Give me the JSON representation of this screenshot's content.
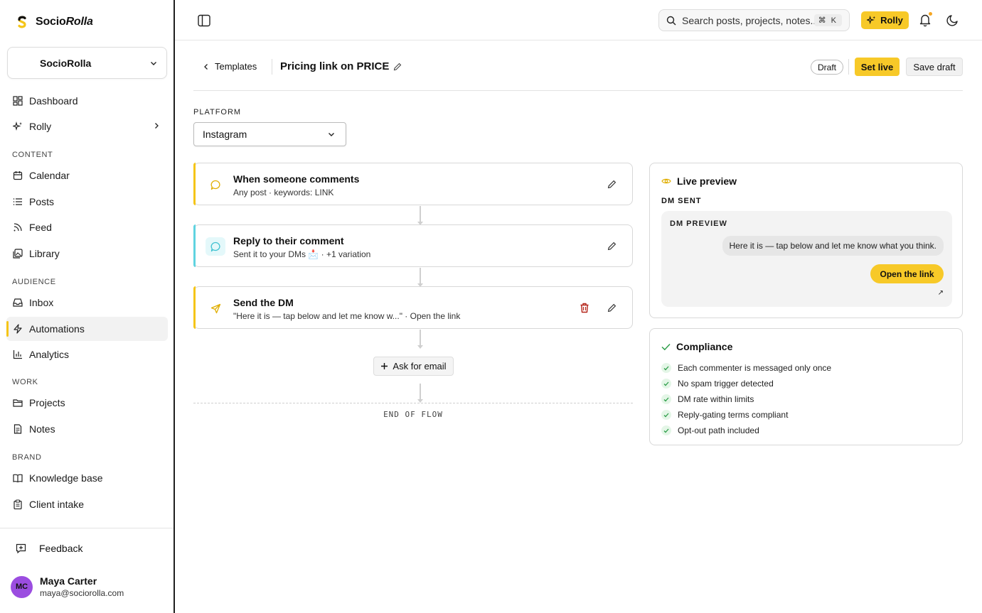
{
  "brand": {
    "name_plain": "Socio",
    "name_italic": "Rolla"
  },
  "workspace": {
    "name": "SocioRolla"
  },
  "nav": {
    "dashboard": "Dashboard",
    "rolly": "Rolly",
    "sections": {
      "content": "CONTENT",
      "audience": "AUDIENCE",
      "work": "WORK",
      "brand": "BRAND"
    },
    "calendar": "Calendar",
    "posts": "Posts",
    "feed": "Feed",
    "library": "Library",
    "inbox": "Inbox",
    "automations": "Automations",
    "analytics": "Analytics",
    "projects": "Projects",
    "notes": "Notes",
    "knowledge_base": "Knowledge base",
    "client_intake": "Client intake",
    "active": "automations"
  },
  "feedback": "Feedback",
  "user": {
    "initials": "MC",
    "name": "Maya Carter",
    "email": "maya@sociorolla.com",
    "avatar_color": "#9b4de0"
  },
  "topbar": {
    "search_placeholder": "Search posts, projects, notes...",
    "search_shortcut": "⌘ K",
    "rolly_label": "Rolly"
  },
  "header": {
    "back_label": "Templates",
    "title": "Pricing link on PRICE",
    "status": "Draft",
    "set_live": "Set live",
    "save_draft": "Save draft"
  },
  "platform": {
    "label": "PLATFORM",
    "value": "Instagram"
  },
  "flow": {
    "steps": [
      {
        "title": "When someone comments",
        "subtitle": "Any post · keywords: LINK",
        "accent": "#f5c518",
        "icon": "comment-icon"
      },
      {
        "title": "Reply to their comment",
        "subtitle": "Sent it to your DMs 📩 · +1 variation",
        "accent": "#5fd3e0",
        "icon": "comment-icon"
      },
      {
        "title": "Send the DM",
        "subtitle": "\"Here it is — tap below and let me know w...\" · Open the link",
        "accent": "#f5c518",
        "icon": "send-icon"
      }
    ],
    "ask_email": "Ask for email",
    "end": "END OF FLOW"
  },
  "preview": {
    "title": "Live preview",
    "state": "DM SENT",
    "box_label": "DM PREVIEW",
    "message": "Here it is — tap below and let me know what you think.",
    "button": "Open the link",
    "arrow": "↗"
  },
  "compliance": {
    "title": "Compliance",
    "items": [
      "Each commenter is messaged only once",
      "No spam trigger detected",
      "DM rate within limits",
      "Reply-gating terms compliant",
      "Opt-out path included"
    ]
  },
  "colors": {
    "accent": "#f7c928",
    "success": "#2e9e4a",
    "danger": "#b42318"
  }
}
